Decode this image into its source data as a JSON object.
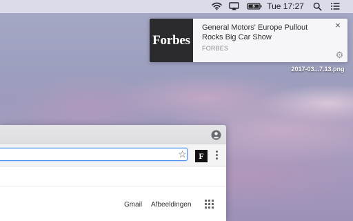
{
  "menubar": {
    "icons": [
      "wifi-icon",
      "airplay-icon",
      "battery-charging-icon",
      "spotlight-search-icon",
      "notification-center-icon"
    ],
    "clock": "Tue 17:27"
  },
  "notification": {
    "logo_text": "Forbes",
    "title": "General Motors' Europe Pullout Rocks Big Car Show",
    "source": "FORBES",
    "close_glyph": "×",
    "settings_glyph": "⚙"
  },
  "desktop": {
    "file_label": "2017-03...7.13.png"
  },
  "browser": {
    "address_value": "",
    "extension_glyph": "F",
    "links": {
      "gmail": "Gmail",
      "images": "Afbeeldingen"
    }
  },
  "colors": {
    "focus_ring": "#4a90f4",
    "forbes_logo_bg": "#2b2b2e",
    "menubar_bg": "#efeff6"
  }
}
